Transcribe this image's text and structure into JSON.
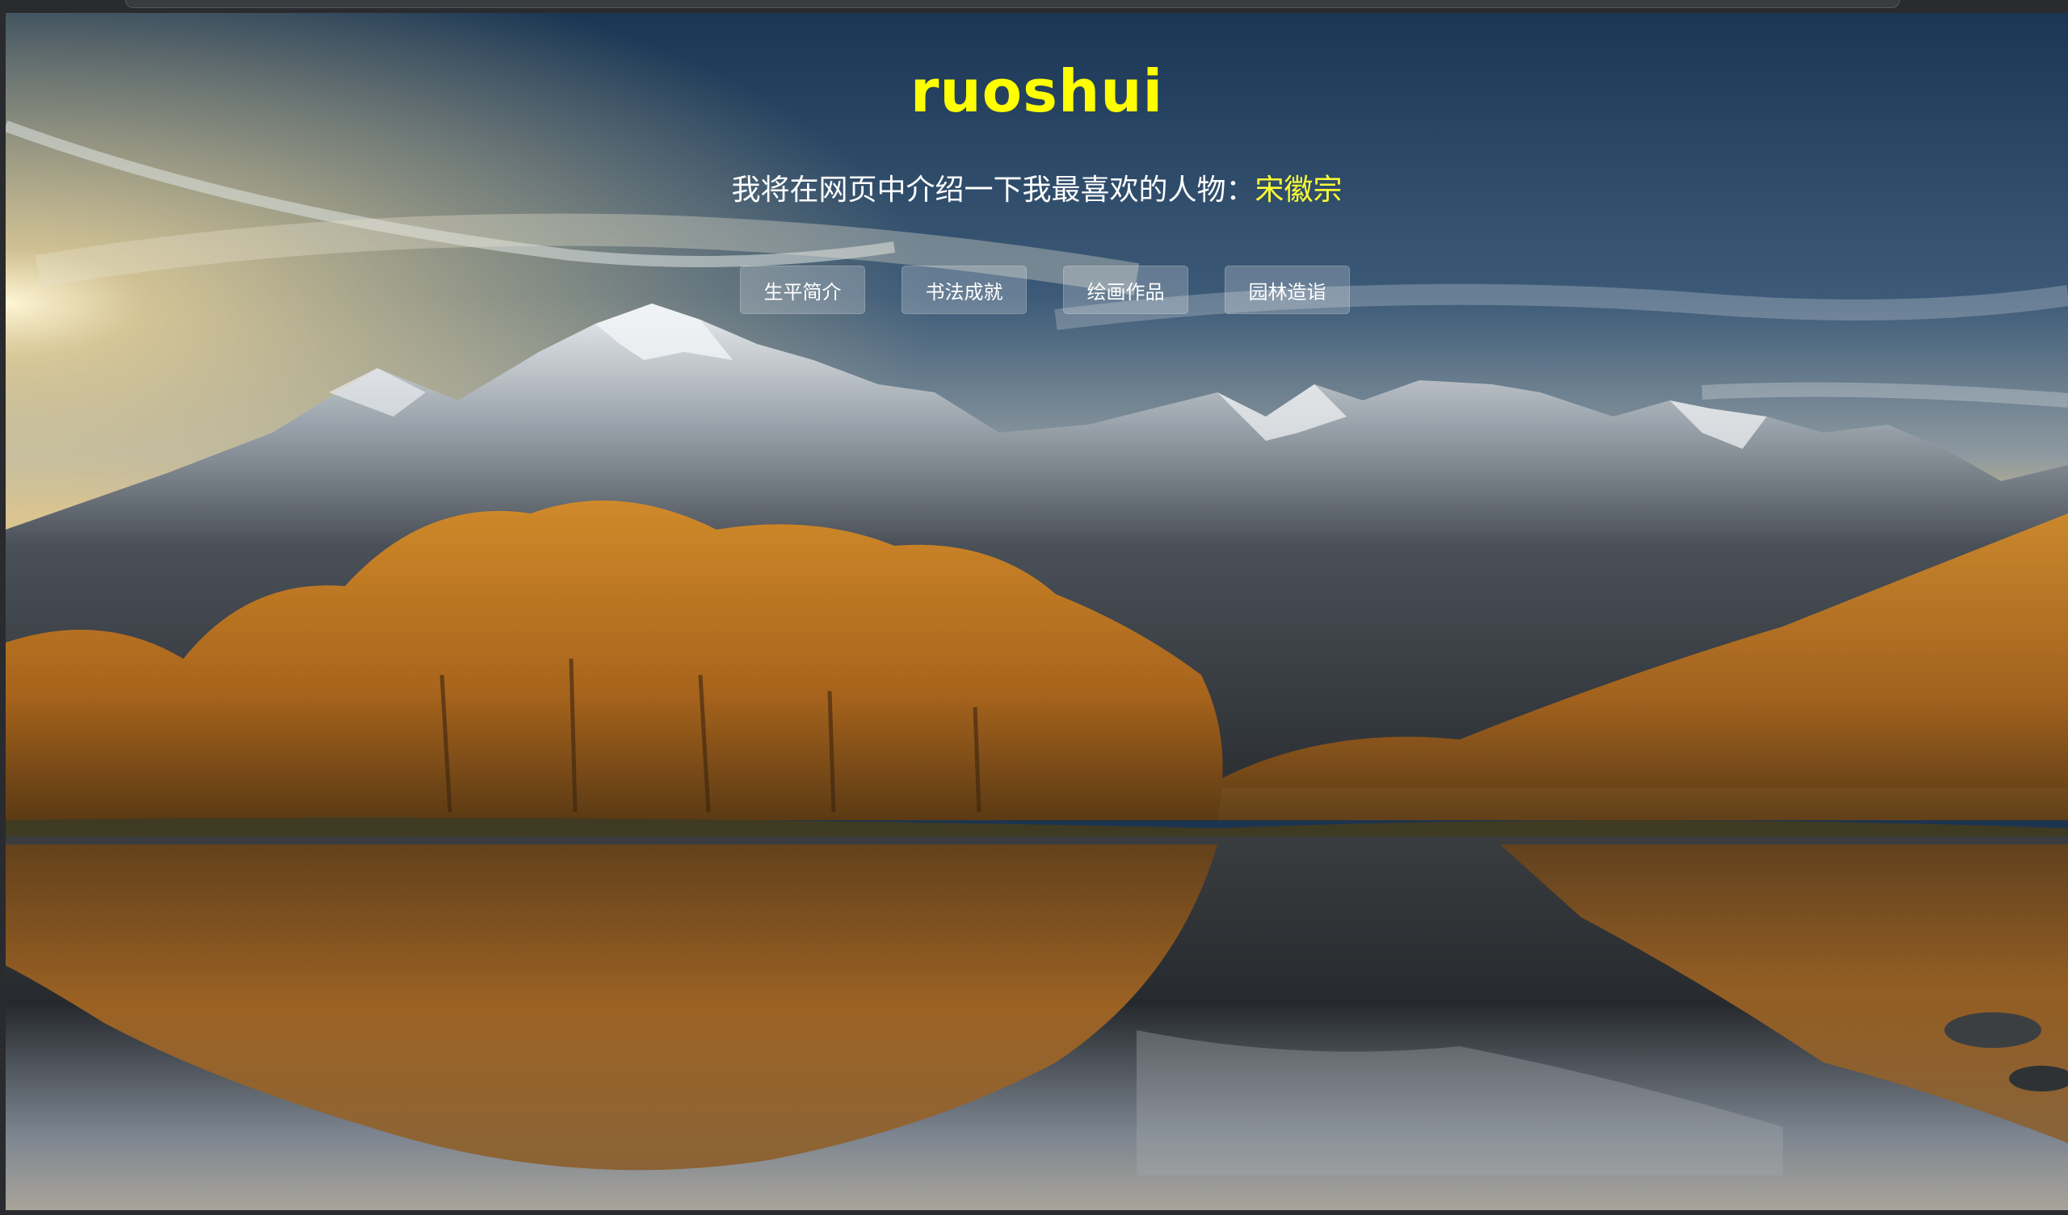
{
  "hero": {
    "title": "ruoshui",
    "subtitle_prefix": "我将在网页中介绍一下我最喜欢的人物：",
    "subtitle_highlight": "宋徽宗"
  },
  "nav": {
    "items": [
      {
        "label": "生平简介"
      },
      {
        "label": "书法成就"
      },
      {
        "label": "绘画作品"
      },
      {
        "label": "园林造诣"
      }
    ]
  },
  "colors": {
    "title": "#ffff00",
    "highlight": "#ffff33",
    "text": "#ffffff"
  },
  "background": {
    "icon": "autumn-lake-mountain-landscape"
  }
}
